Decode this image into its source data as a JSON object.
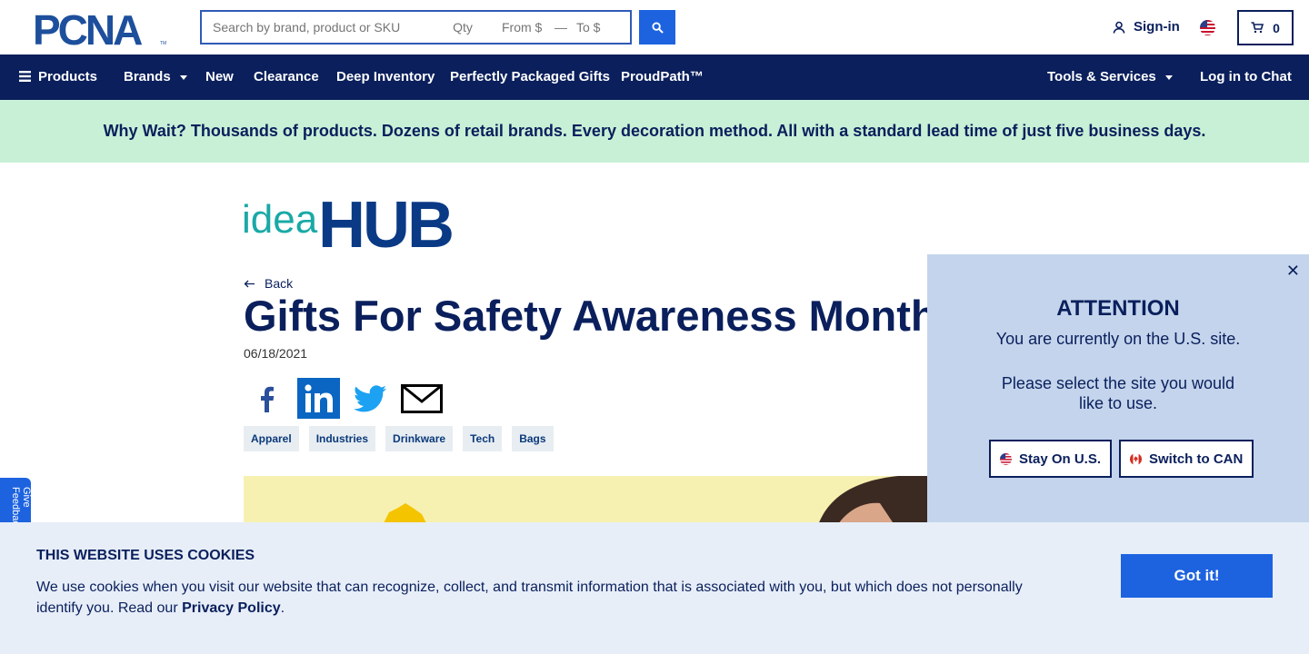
{
  "brand": {
    "logo_text": "PCNA"
  },
  "search": {
    "main_placeholder": "Search by brand, product or SKU",
    "qty_placeholder": "Qty",
    "from_placeholder": "From $",
    "dash": "—",
    "to_placeholder": "To $"
  },
  "header": {
    "signin": "Sign-in",
    "cart_count": "0"
  },
  "nav": {
    "products": "Products",
    "brands": "Brands",
    "new": "New",
    "clearance": "Clearance",
    "deep_inventory": "Deep Inventory",
    "gifts": "Perfectly Packaged Gifts",
    "proudpath": "ProudPath™",
    "tools": "Tools & Services",
    "chat": "Log in to Chat"
  },
  "promo": {
    "text": "Why Wait? Thousands of products. Dozens of retail brands. Every decoration method. All with a standard lead time of just five business days."
  },
  "article": {
    "hub_idea": "idea",
    "hub_hub": "HUB",
    "back": "Back",
    "title": "Gifts For Safety Awareness Month",
    "date": "06/18/2021",
    "tags": [
      "Apparel",
      "Industries",
      "Drinkware",
      "Tech",
      "Bags"
    ]
  },
  "feedback": {
    "label": "Give Feedback"
  },
  "modal": {
    "heading": "ATTENTION",
    "line1": "You are currently on the U.S. site.",
    "line2": "Please select the site you would",
    "line3": "like to use.",
    "stay_label": "Stay On U.S.",
    "switch_label": "Switch to CAN"
  },
  "cookie": {
    "heading": "THIS WEBSITE USES COOKIES",
    "text": "We use cookies when you visit our website that can recognize, collect, and transmit information that is associated with you, but which does not personally identify you. Read our",
    "link": "Privacy Policy",
    "period": ".",
    "button": "Got it!"
  },
  "colors": {
    "navy": "#0a1f5c",
    "accent": "#1d63e0",
    "promo_bg": "#c8f0d6",
    "teal": "#1aa9a6"
  }
}
